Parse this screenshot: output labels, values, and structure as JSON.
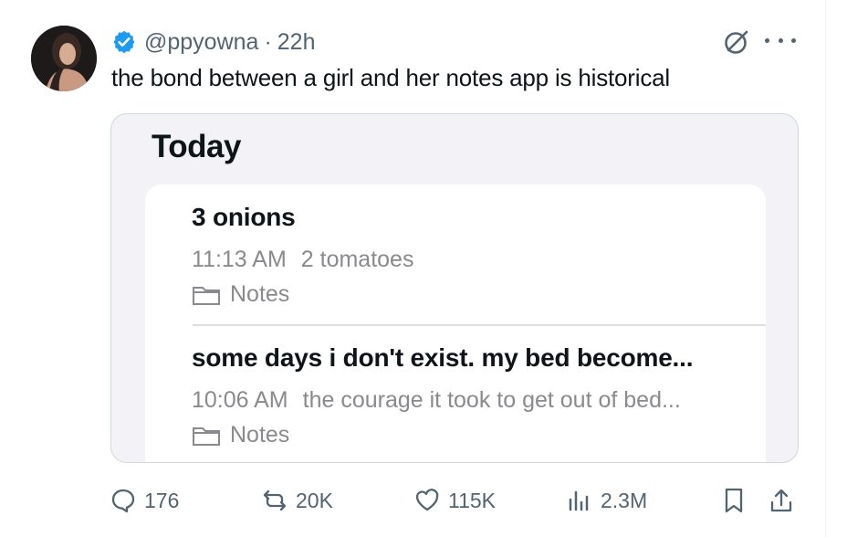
{
  "post": {
    "handle": "@ppyowna",
    "separator": "·",
    "time": "22h",
    "text": "the bond between a girl and her notes app is historical"
  },
  "notes_app": {
    "section_title": "Today",
    "notes": [
      {
        "title": "3 onions",
        "time": "11:13 AM",
        "preview": "2 tomatoes",
        "folder": "Notes"
      },
      {
        "title": "some days i don't exist. my bed become...",
        "time": "10:06 AM",
        "preview": "the courage it took to get out of bed...",
        "folder": "Notes"
      }
    ]
  },
  "actions": {
    "replies": "176",
    "reposts": "20K",
    "likes": "115K",
    "views": "2.3M"
  },
  "icons": [
    "verified-icon",
    "grok-icon",
    "more-icon",
    "folder-icon",
    "reply-icon",
    "repost-icon",
    "like-icon",
    "views-icon",
    "bookmark-icon",
    "share-icon"
  ],
  "colors": {
    "verified": "#1d9bf0",
    "secondary_text": "#536471",
    "notes_background": "#f2f2f7",
    "notes_meta": "#8a8a8e"
  }
}
